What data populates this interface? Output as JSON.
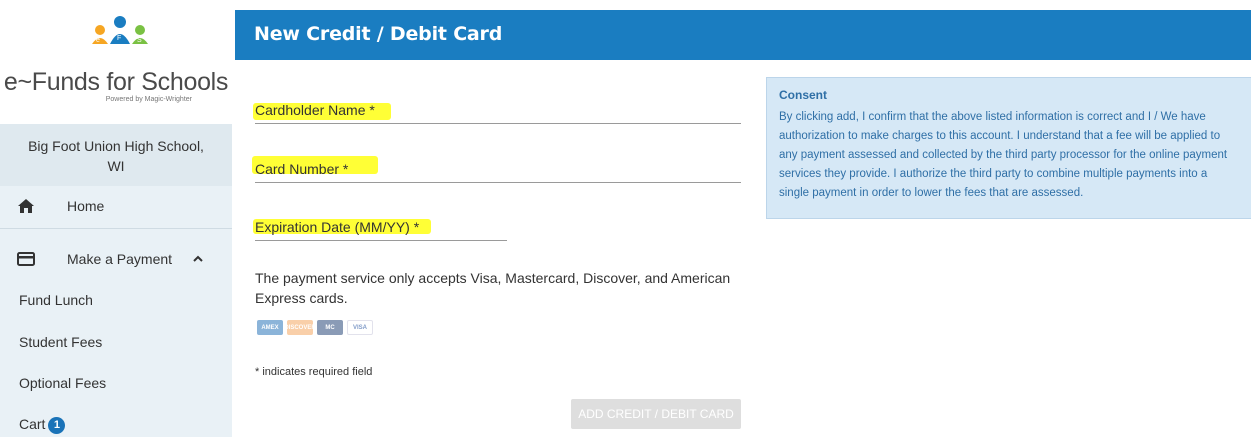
{
  "sidebar": {
    "brand": "e~Funds for Schools",
    "brand_sub": "Powered by Magic-Wrighter",
    "school": "Big Foot Union High School, WI",
    "nav": {
      "home": "Home",
      "make_payment": "Make a Payment",
      "fund_lunch": "Fund Lunch",
      "student_fees": "Student Fees",
      "optional_fees": "Optional Fees",
      "cart": "Cart",
      "cart_count": "1"
    }
  },
  "header": {
    "title": "New Credit / Debit Card"
  },
  "form": {
    "cardholder_label": "Cardholder Name *",
    "card_number_label": "Card Number *",
    "expiration_label": "Expiration Date (MM/YY) *",
    "note": "The payment service only accepts Visa, Mastercard, Discover, and American Express cards.",
    "required_note": "* indicates required field",
    "submit": "ADD CREDIT / DEBIT CARD",
    "cards": [
      "AMEX",
      "DISCOVER",
      "MC",
      "VISA"
    ]
  },
  "consent": {
    "title": "Consent",
    "body": "By clicking add, I confirm that the above listed information is correct and I / We have authorization to make charges to this account. I understand that a fee will be applied to any payment assessed and collected by the third party processor for the online payment services they provide. I authorize the third party to combine multiple payments into a single payment in order to lower the fees that are assessed."
  },
  "colors": {
    "header": "#1a7dc1",
    "sidebar": "#e9f1f6",
    "highlight": "#ffff20",
    "consent_bg": "#d6e8f6"
  }
}
